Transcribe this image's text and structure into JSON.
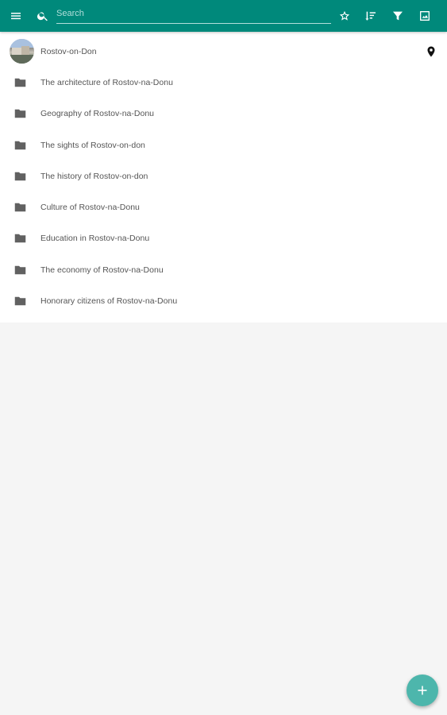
{
  "toolbar": {
    "menu_icon": "menu-icon",
    "search_icon": "search-icon",
    "search_placeholder": "Search",
    "search_value": "",
    "actions": [
      {
        "icon": "star-outline-icon"
      },
      {
        "icon": "sort-icon"
      },
      {
        "icon": "filter-icon"
      },
      {
        "icon": "image-icon"
      }
    ],
    "background_color": "#00897b"
  },
  "list": {
    "header_item": {
      "label": "Rostov-on-Don",
      "icon": "avatar-photo",
      "trailing_icon": "location-pin-icon"
    },
    "folders": [
      {
        "label": "The architecture of Rostov-na-Donu",
        "icon": "folder-icon"
      },
      {
        "label": "Geography of Rostov-na-Donu",
        "icon": "folder-icon"
      },
      {
        "label": "The sights of Rostov-on-don",
        "icon": "folder-icon"
      },
      {
        "label": "The history of Rostov-on-don",
        "icon": "folder-icon"
      },
      {
        "label": "Culture of Rostov-na-Donu",
        "icon": "folder-icon"
      },
      {
        "label": "Education in Rostov-na-Donu",
        "icon": "folder-icon"
      },
      {
        "label": "The economy of Rostov-na-Donu",
        "icon": "folder-icon"
      },
      {
        "label": "Honorary citizens of Rostov-na-Donu",
        "icon": "folder-icon"
      }
    ]
  },
  "fab": {
    "icon": "add-icon",
    "color": "#4db6ac"
  }
}
